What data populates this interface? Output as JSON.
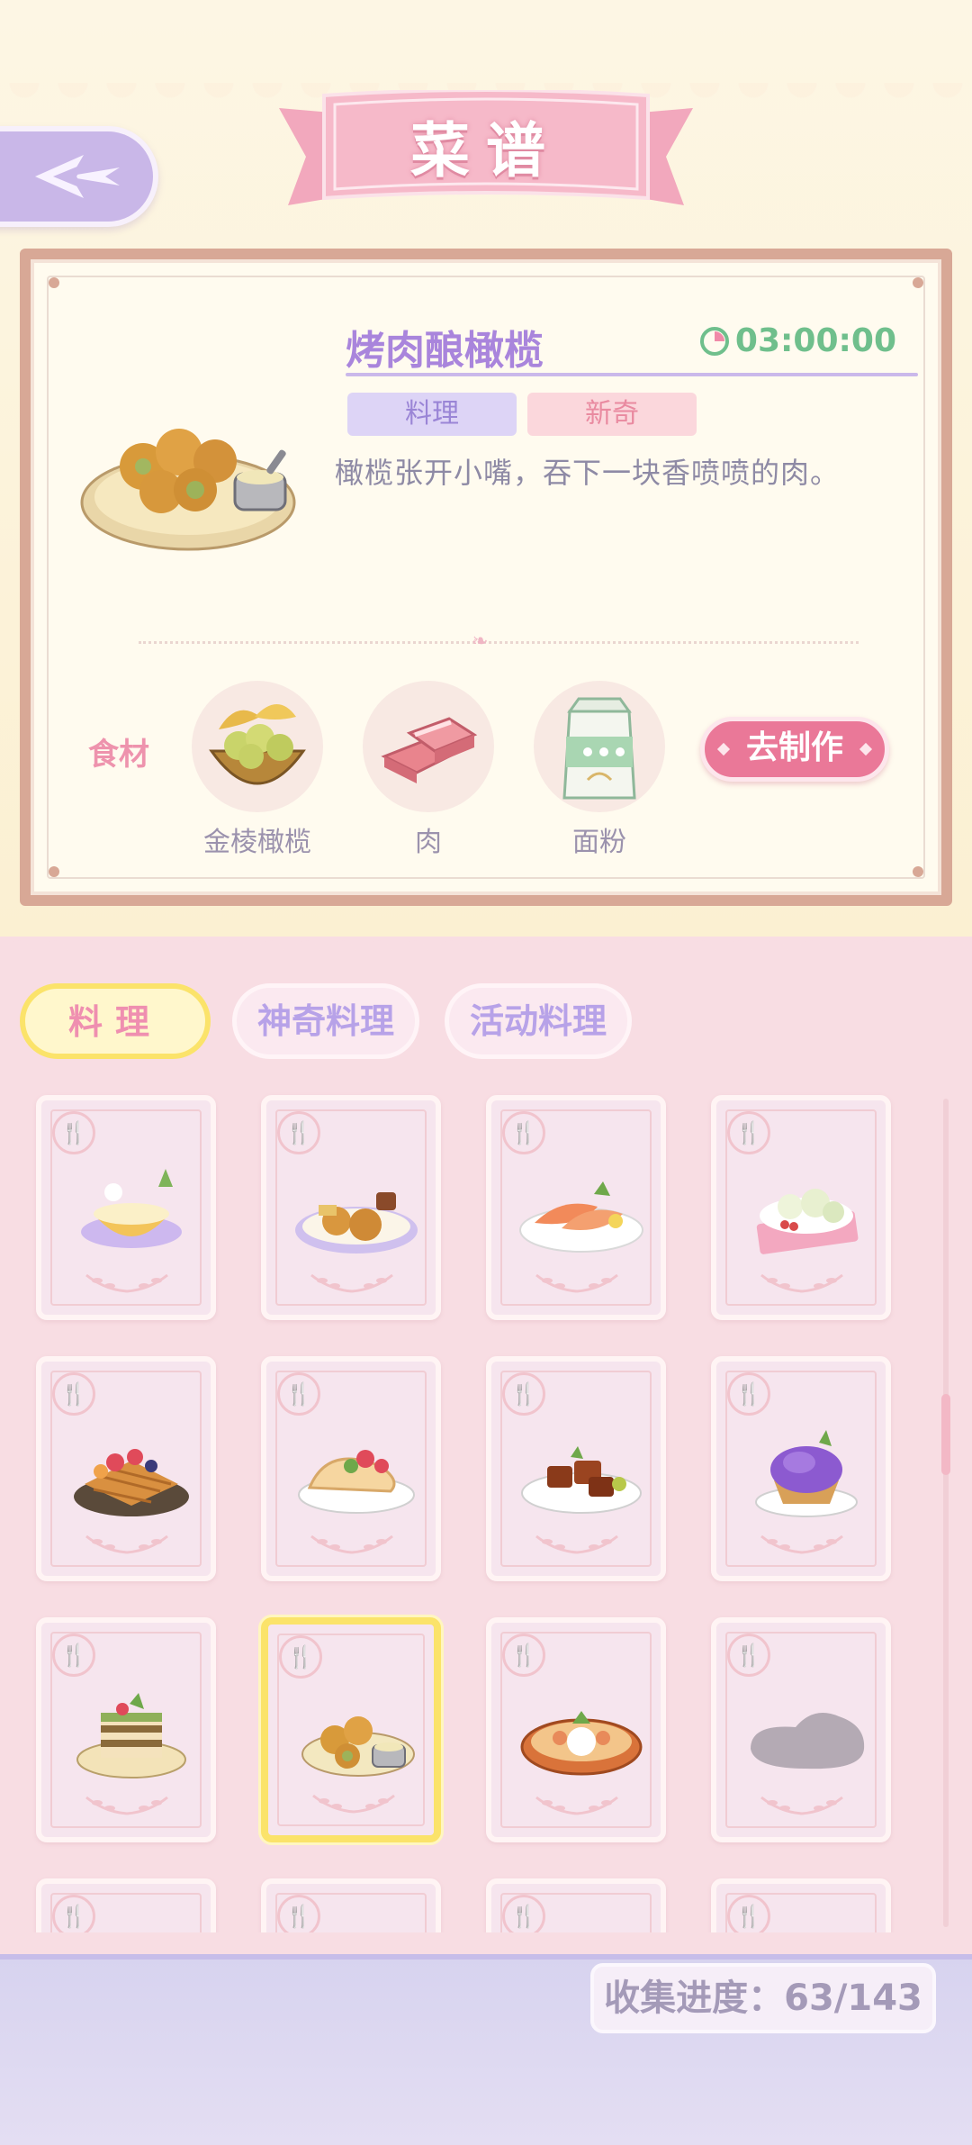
{
  "header": {
    "title": "菜谱",
    "back_icon": "back-arrow-icon"
  },
  "detail": {
    "dish_name": "烤肉酿橄榄",
    "timer": "03:00:00",
    "tags": [
      "料理",
      "新奇"
    ],
    "description": "橄榄张开小嘴，吞下一块香喷喷的肉。",
    "ingredients_label": "食材",
    "ingredients": [
      {
        "name": "金棱橄榄",
        "icon": "golden-olive-icon"
      },
      {
        "name": "肉",
        "icon": "meat-icon"
      },
      {
        "name": "面粉",
        "icon": "flour-icon"
      }
    ],
    "make_button": "去制作"
  },
  "tabs": [
    {
      "label": "料理",
      "active": true
    },
    {
      "label": "神奇料理",
      "active": false
    },
    {
      "label": "活动料理",
      "active": false
    }
  ],
  "recipes": [
    {
      "dish": "pineapple-soup",
      "selected": false,
      "locked": false
    },
    {
      "dish": "fried-platter",
      "selected": false,
      "locked": false
    },
    {
      "dish": "salmon-sashimi",
      "selected": false,
      "locked": false
    },
    {
      "dish": "cauliflower-salad",
      "selected": false,
      "locked": false
    },
    {
      "dish": "fruit-waffle",
      "selected": false,
      "locked": false
    },
    {
      "dish": "fruit-taco",
      "selected": false,
      "locked": false
    },
    {
      "dish": "braised-pork",
      "selected": false,
      "locked": false
    },
    {
      "dish": "purple-tart",
      "selected": false,
      "locked": false
    },
    {
      "dish": "matcha-cake",
      "selected": false,
      "locked": false
    },
    {
      "dish": "meat-stuffed-olives",
      "selected": true,
      "locked": false
    },
    {
      "dish": "noodle-soup",
      "selected": false,
      "locked": false
    },
    {
      "dish": "unknown",
      "selected": false,
      "locked": true
    }
  ],
  "footer": {
    "progress_label": "收集进度：",
    "progress_value": "63/143",
    "collected": 63,
    "total": 143
  },
  "colors": {
    "accent_purple": "#a985dc",
    "accent_pink": "#ea7898",
    "timer_green": "#6fbf8c",
    "selected_yellow": "#fbe36a"
  }
}
